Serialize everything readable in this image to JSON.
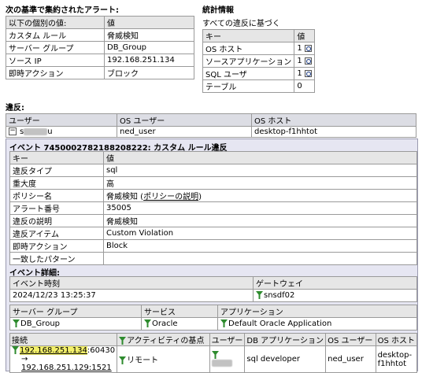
{
  "aggregated": {
    "title": "次の基準で集約されたアラート:",
    "header": [
      "以下の個別の値:",
      "値"
    ],
    "rows": [
      {
        "key": "カスタム ルール",
        "value": "脅威検知"
      },
      {
        "key": "サーバー グループ",
        "value": "DB_Group"
      },
      {
        "key": "ソース IP",
        "value": "192.168.251.134"
      },
      {
        "key": "即時アクション",
        "value": "ブロック"
      }
    ]
  },
  "stats": {
    "title": "統計情報",
    "subtitle": "すべての違反に基づく",
    "header": [
      "キー",
      "値"
    ],
    "rows": [
      {
        "key": "OS ホスト",
        "value": "1"
      },
      {
        "key": "ソースアプリケーション",
        "value": "1"
      },
      {
        "key": "SQL ユーザ",
        "value": "1"
      },
      {
        "key": "テーブル",
        "value": "0"
      }
    ]
  },
  "violations": {
    "title": "違反:",
    "header": [
      "ユーザー",
      "OS ユーザー",
      "OS ホスト"
    ],
    "row": {
      "expander": "−",
      "user_prefix": "s",
      "user_suffix": "u",
      "os_user": "ned_user",
      "os_host": "desktop-f1hhtot"
    }
  },
  "event": {
    "title": "イベント 7450002782188208222: カスタム ルール違反",
    "header": [
      "キー",
      "値"
    ],
    "rows": [
      {
        "key": "違反タイプ",
        "value": "sql"
      },
      {
        "key": "重大度",
        "value": "高"
      },
      {
        "key": "ポリシー名",
        "value": "脅威検知",
        "link": "ポリシーの説明"
      },
      {
        "key": "アラート番号",
        "value": "35005"
      },
      {
        "key": "違反の説明",
        "value": "脅威検知"
      },
      {
        "key": "違反アイテム",
        "value": "Custom Violation"
      },
      {
        "key": "即時アクション",
        "value": "Block"
      },
      {
        "key": "一致したパターン",
        "value": ""
      }
    ]
  },
  "details": {
    "title": "イベント詳細:",
    "time_header": "イベント時刻",
    "time_value": "2024/12/23 13:25:37",
    "gateway_header": "ゲートウェイ",
    "gateway_value": "snsdf02",
    "server_group_header": "サーバー グループ",
    "server_group_value": "DB_Group",
    "service_header": "サービス",
    "service_value": "Oracle",
    "app_header": "アプリケーション",
    "app_value": "Default Oracle Application"
  },
  "connection": {
    "headers": [
      "接続",
      "アクティビティの基点",
      "ユーザー",
      "DB アプリケーション",
      "OS ユーザー",
      "OS ホスト"
    ],
    "src_ip": "192.168.251.134",
    "src_port": ":60430",
    "arrow": "→",
    "dst": "192.168.251.129:1521",
    "origin": "リモート",
    "db_app": "sql developer",
    "os_user": "ned_user",
    "os_host": "desktop-f1hhtot"
  },
  "colors": {
    "panel_bg": "#e6e6f2",
    "highlight": "#f3f06a",
    "funnel": "#2e8b2e"
  }
}
